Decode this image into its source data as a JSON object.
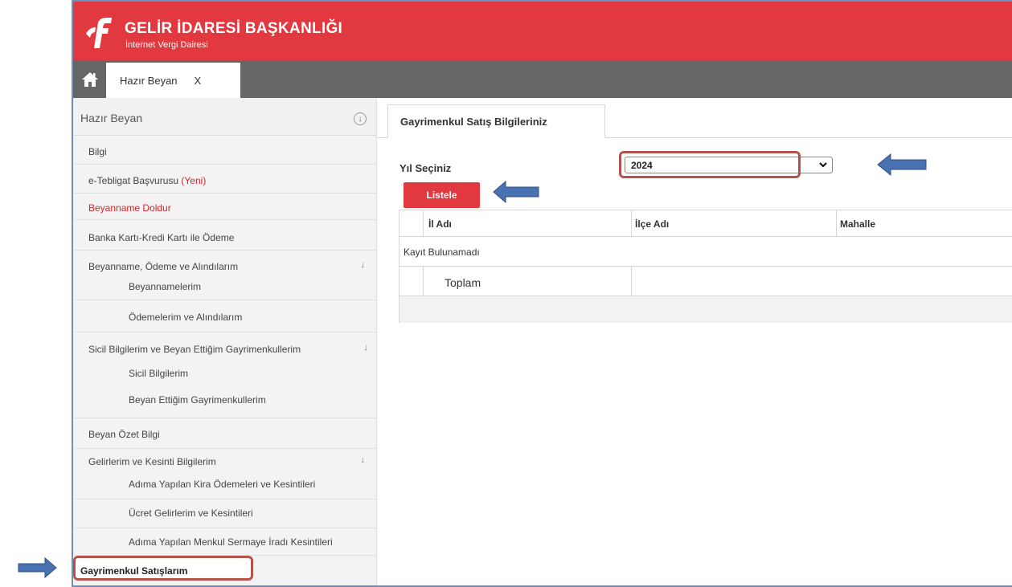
{
  "header": {
    "title": "GELİR İDARESİ BAŞKANLIĞI",
    "subtitle": "İnternet Vergi Dairesi",
    "logo_icon": "gib-logo-icon",
    "color": "#e2383f"
  },
  "tabbar": {
    "home_icon": "home-icon",
    "tab_label": "Hazır Beyan",
    "tab_close": "X"
  },
  "sidebar": {
    "header": "Hazır Beyan",
    "collapse_icon": "↓",
    "items": [
      {
        "label": "Bilgi"
      },
      {
        "label": "e-Tebligat Başvurusu",
        "badge": "(Yeni)"
      },
      {
        "label": "Beyanname Doldur"
      },
      {
        "label": "Banka Kartı-Kredi Kartı ile Ödeme"
      },
      {
        "label": "Beyanname, Ödeme ve Alındılarım",
        "arrow": "↓"
      },
      {
        "label": "Beyannamelerim"
      },
      {
        "label": "Ödemelerim ve Alındılarım"
      },
      {
        "label": "Sicil Bilgilerim ve Beyan Ettiğim Gayrimenkullerim",
        "arrow": "↓"
      },
      {
        "label": "Sicil Bilgilerim"
      },
      {
        "label": "Beyan Ettiğim Gayrimenkullerim"
      },
      {
        "label": "Beyan Özet Bilgi"
      },
      {
        "label": "Gelirlerim ve Kesinti Bilgilerim",
        "arrow": "↓"
      },
      {
        "label": "Adıma Yapılan Kira Ödemeleri ve Kesintileri"
      },
      {
        "label": "Ücret Gelirlerim ve Kesintileri"
      },
      {
        "label": "Adıma Yapılan Menkul Sermaye İradı Kesintileri"
      },
      {
        "label": "Gayrimenkul Satışlarım"
      }
    ]
  },
  "main": {
    "tab_label": "Gayrimenkul Satış Bilgileriniz",
    "year_label": "Yıl Seçiniz",
    "year_value": "2024",
    "list_button": "Listele",
    "table": {
      "columns": [
        "İl Adı",
        "İlçe Adı",
        "Mahalle"
      ],
      "empty_message": "Kayıt Bulunamadı",
      "total_label": "Toplam"
    }
  },
  "colors": {
    "brand_red": "#e2383f",
    "highlight_box": "#b5524f",
    "arrow_blue": "#4a72b2"
  }
}
